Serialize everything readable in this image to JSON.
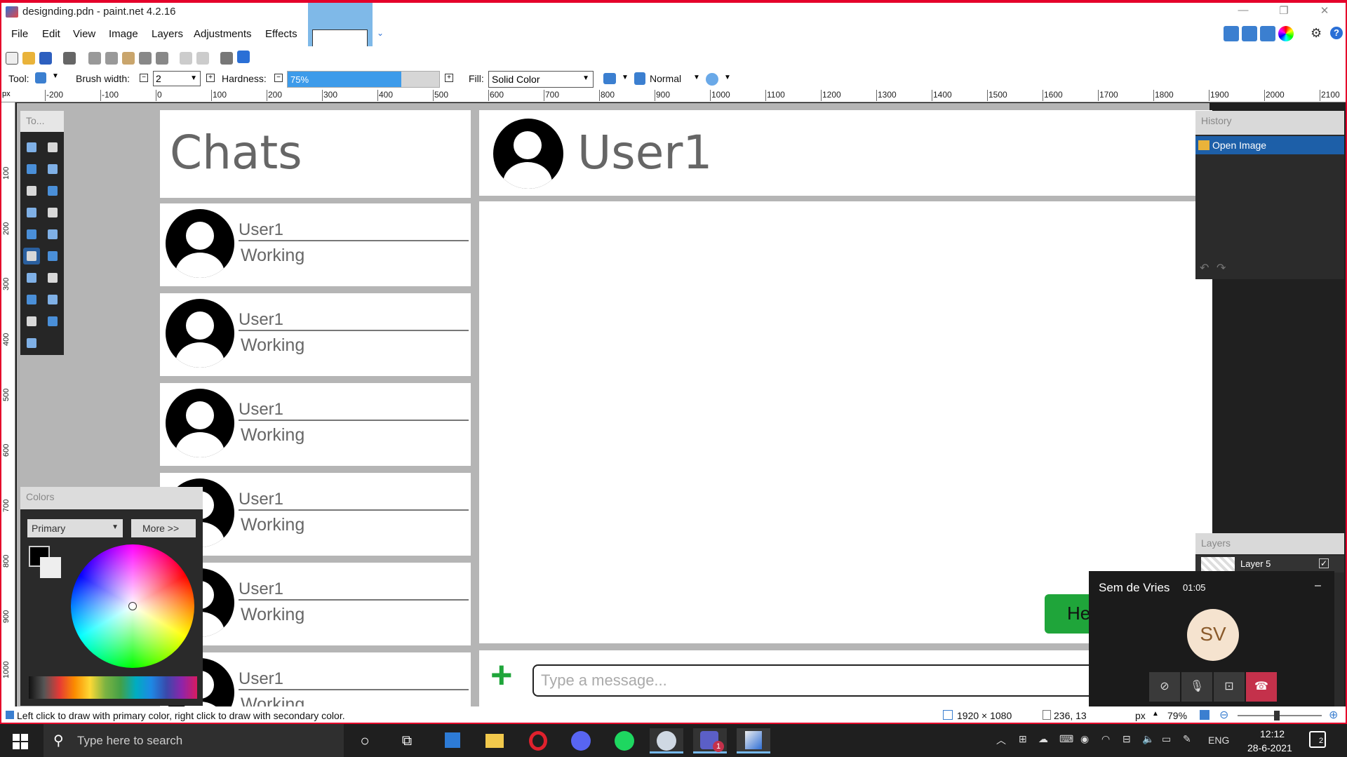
{
  "window": {
    "title": "designding.pdn - paint.net 4.2.16"
  },
  "menu": [
    "File",
    "Edit",
    "View",
    "Image",
    "Layers",
    "Adjustments",
    "Effects"
  ],
  "toolbar": {
    "tool_label": "Tool:",
    "brush_width_label": "Brush width:",
    "brush_width_value": "2",
    "hardness_label": "Hardness:",
    "hardness_value": "75%",
    "hardness_fraction": 0.75,
    "fill_label": "Fill:",
    "fill_value": "Solid Color",
    "blend_value": "Normal"
  },
  "ruler": {
    "unit": "px",
    "top_labels": [
      "-200",
      "-100",
      "0",
      "100",
      "200",
      "300",
      "400",
      "500",
      "600",
      "700",
      "800",
      "900",
      "1000",
      "1100",
      "1200",
      "1300",
      "1400",
      "1500",
      "1600",
      "1700",
      "1800",
      "1900",
      "2000",
      "2100"
    ],
    "left_labels": [
      "100",
      "200",
      "300",
      "400",
      "500",
      "600",
      "700",
      "800",
      "900",
      "1000"
    ]
  },
  "tools_panel": {
    "title": "To..."
  },
  "colors_panel": {
    "title": "Colors",
    "mode": "Primary",
    "more_label": "More >>"
  },
  "history_panel": {
    "title": "History",
    "items": [
      "Open Image"
    ]
  },
  "layers_panel": {
    "title": "Layers",
    "items": [
      {
        "name": "Layer 5",
        "visible": true
      }
    ]
  },
  "design": {
    "sidebar_title": "Chats",
    "chats": [
      {
        "name": "User1",
        "status": "Working"
      },
      {
        "name": "User1",
        "status": "Working"
      },
      {
        "name": "User1",
        "status": "Working"
      },
      {
        "name": "User1",
        "status": "Working"
      },
      {
        "name": "User1",
        "status": "Working"
      },
      {
        "name": "User1",
        "status": "Working"
      }
    ],
    "conversation_title": "User1",
    "message_bubble": "He",
    "composer_placeholder": "Type a message...",
    "add_symbol": "+"
  },
  "status": {
    "hint": "Left click to draw with primary color, right click to draw with secondary color.",
    "image_size": "1920 × 1080",
    "cursor_pos": "236, 13",
    "unit": "px",
    "zoom": "79%"
  },
  "call": {
    "caller": "Sem de Vries",
    "duration": "01:05",
    "initials": "SV",
    "minimize": "–"
  },
  "taskbar": {
    "search_placeholder": "Type here to search",
    "language": "ENG",
    "time": "12:12",
    "date": "28-6-2021",
    "notifications": "2",
    "teams_badge": "1"
  },
  "colors": {
    "accent": "#1e88e5",
    "composer_plus": "#1fa53a",
    "bubble": "#1fa53a",
    "frame": "#e5002a",
    "end_call": "#c4314b",
    "avatar_bg": "#f5e3cf"
  }
}
